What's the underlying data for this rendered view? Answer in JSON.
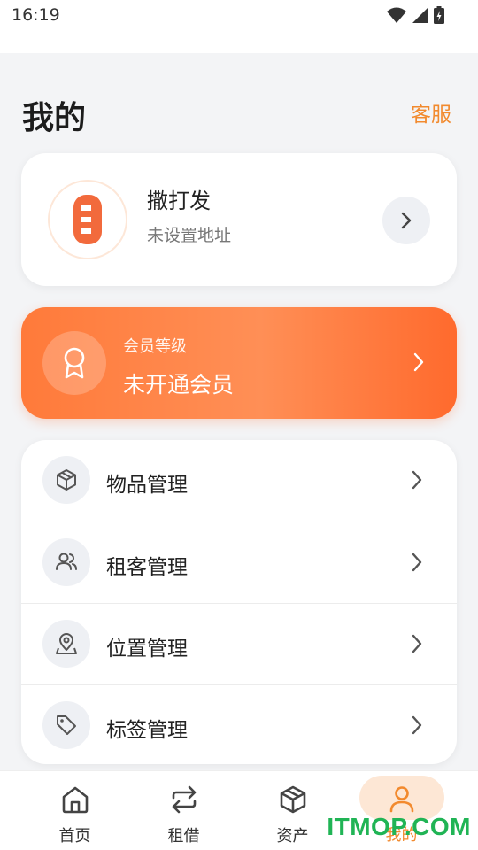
{
  "status_bar": {
    "time": "16:19"
  },
  "header": {
    "title": "我的",
    "service_link": "客服"
  },
  "profile": {
    "name": "撒打发",
    "address": "未设置地址"
  },
  "member": {
    "label": "会员等级",
    "status": "未开通会员"
  },
  "menu": {
    "items": [
      {
        "label": "物品管理",
        "icon": "box-icon"
      },
      {
        "label": "租客管理",
        "icon": "users-icon"
      },
      {
        "label": "位置管理",
        "icon": "location-pin-icon"
      },
      {
        "label": "标签管理",
        "icon": "tag-icon"
      }
    ]
  },
  "bottom_nav": {
    "items": [
      {
        "label": "首页",
        "icon": "home-icon"
      },
      {
        "label": "租借",
        "icon": "swap-icon"
      },
      {
        "label": "资产",
        "icon": "box-icon"
      },
      {
        "label": "我的",
        "icon": "user-icon"
      }
    ],
    "active_index": 3
  },
  "watermark": "ITMOP.COM",
  "colors": {
    "accent": "#f28a2e",
    "member_gradient_start": "#ff7a3a",
    "member_gradient_end": "#ff6a2d",
    "page_bg": "#f3f4f6",
    "watermark": "#20b455"
  }
}
